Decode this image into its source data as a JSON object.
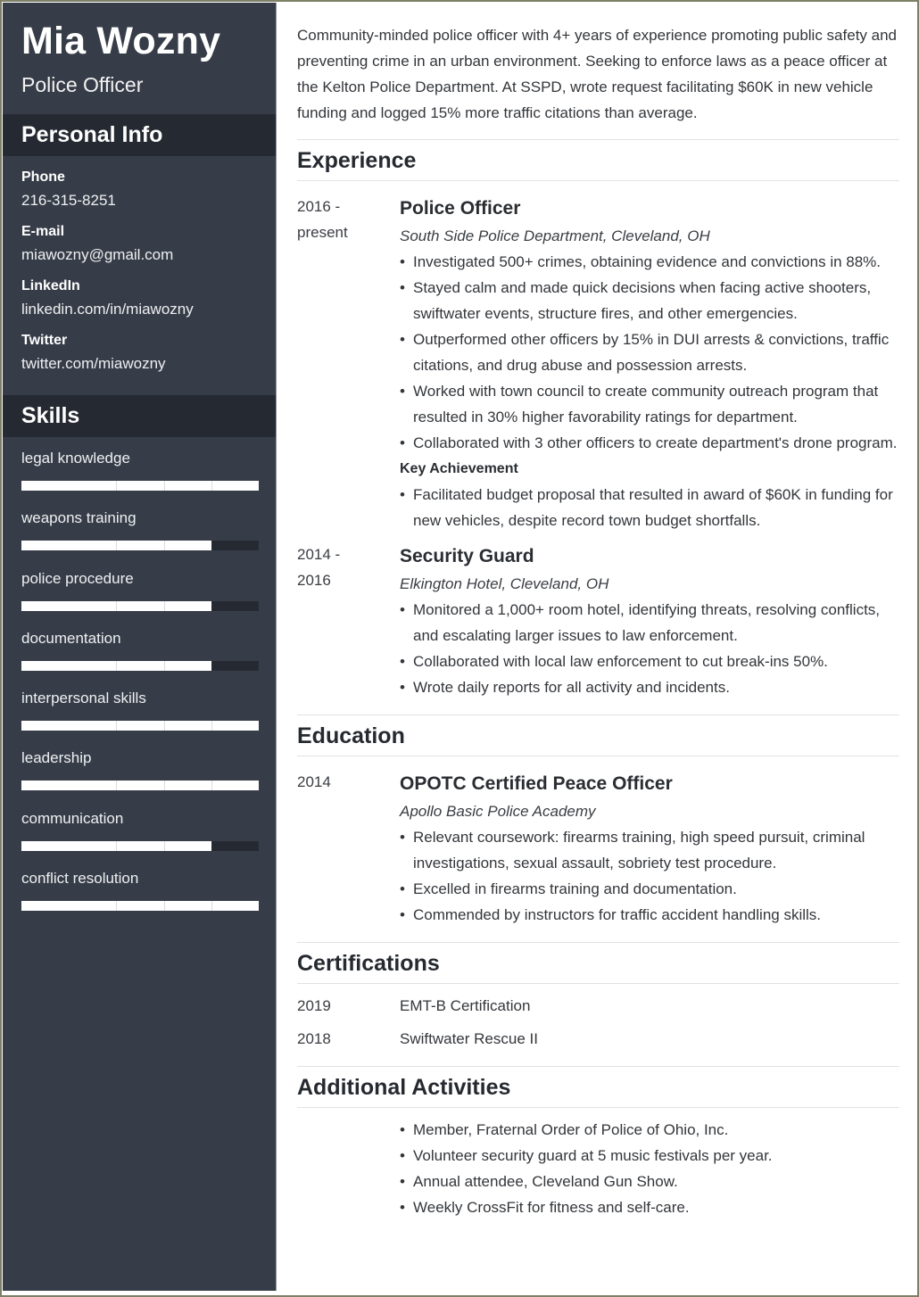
{
  "header": {
    "name": "Mia Wozny",
    "role": "Police Officer"
  },
  "personal_info": {
    "heading": "Personal Info",
    "items": [
      {
        "label": "Phone",
        "value": "216-315-8251"
      },
      {
        "label": "E-mail",
        "value": "miawozny@gmail.com"
      },
      {
        "label": "LinkedIn",
        "value": "linkedin.com/in/miawozny"
      },
      {
        "label": "Twitter",
        "value": "twitter.com/miawozny"
      }
    ]
  },
  "skills": {
    "heading": "Skills",
    "items": [
      {
        "name": "legal knowledge",
        "level": 1.0
      },
      {
        "name": "weapons training",
        "level": 0.8
      },
      {
        "name": "police procedure",
        "level": 0.8
      },
      {
        "name": "documentation",
        "level": 0.8
      },
      {
        "name": "interpersonal skills",
        "level": 1.0
      },
      {
        "name": "leadership",
        "level": 1.0
      },
      {
        "name": "communication",
        "level": 0.8
      },
      {
        "name": "conflict resolution",
        "level": 1.0
      }
    ]
  },
  "summary": "Community-minded police officer with 4+ years of experience promoting public safety and preventing crime in an urban environment. Seeking to enforce laws as a peace officer at the Kelton Police Department. At SSPD, wrote request facilitating $60K in new vehicle funding and logged 15% more traffic citations than average.",
  "experience": {
    "heading": "Experience",
    "jobs": [
      {
        "date_start": "2016 -",
        "date_end": "present",
        "title": "Police Officer",
        "org": "South Side Police Department, Cleveland, OH",
        "bullets": [
          "Investigated 500+ crimes, obtaining evidence and convictions in 88%.",
          "Stayed calm and made quick decisions when facing active shooters, swiftwater events, structure fires, and other emergencies.",
          "Outperformed other officers by 15% in DUI arrests & convictions, traffic citations, and drug abuse and possession arrests.",
          "Worked with town council to create community outreach program that resulted in 30% higher favorability ratings for department.",
          "Collaborated with 3 other officers to create department's drone program."
        ],
        "key_achievement_label": "Key Achievement",
        "key_achievements": [
          "Facilitated budget proposal that resulted in award of $60K in funding for new vehicles, despite record town budget shortfalls."
        ]
      },
      {
        "date_start": "2014 -",
        "date_end": "2016",
        "title": "Security Guard",
        "org": "Elkington Hotel, Cleveland, OH",
        "bullets": [
          "Monitored a 1,000+ room hotel, identifying threats, resolving conflicts, and escalating larger issues to law enforcement.",
          "Collaborated with local law enforcement to cut break-ins 50%.",
          "Wrote daily reports for all activity and incidents."
        ]
      }
    ]
  },
  "education": {
    "heading": "Education",
    "entries": [
      {
        "date": "2014",
        "title": "OPOTC Certified Peace Officer",
        "org": "Apollo Basic Police Academy",
        "bullets": [
          "Relevant coursework: firearms training, high speed pursuit, criminal investigations, sexual assault, sobriety test procedure.",
          "Excelled in firearms training and documentation.",
          "Commended by instructors for traffic accident handling skills."
        ]
      }
    ]
  },
  "certifications": {
    "heading": "Certifications",
    "items": [
      {
        "date": "2019",
        "name": "EMT-B Certification"
      },
      {
        "date": "2018",
        "name": "Swiftwater Rescue II"
      }
    ]
  },
  "activities": {
    "heading": "Additional Activities",
    "items": [
      "Member, Fraternal Order of Police of Ohio, Inc.",
      "Volunteer security guard at 5 music festivals per year.",
      "Annual attendee, Cleveland Gun Show.",
      "Weekly CrossFit for fitness and self-care."
    ]
  },
  "colors": {
    "sidebar_bg": "#373d48",
    "sidebar_heading_bg": "#252a32",
    "frame": "#7e8068",
    "text": "#33363a"
  }
}
